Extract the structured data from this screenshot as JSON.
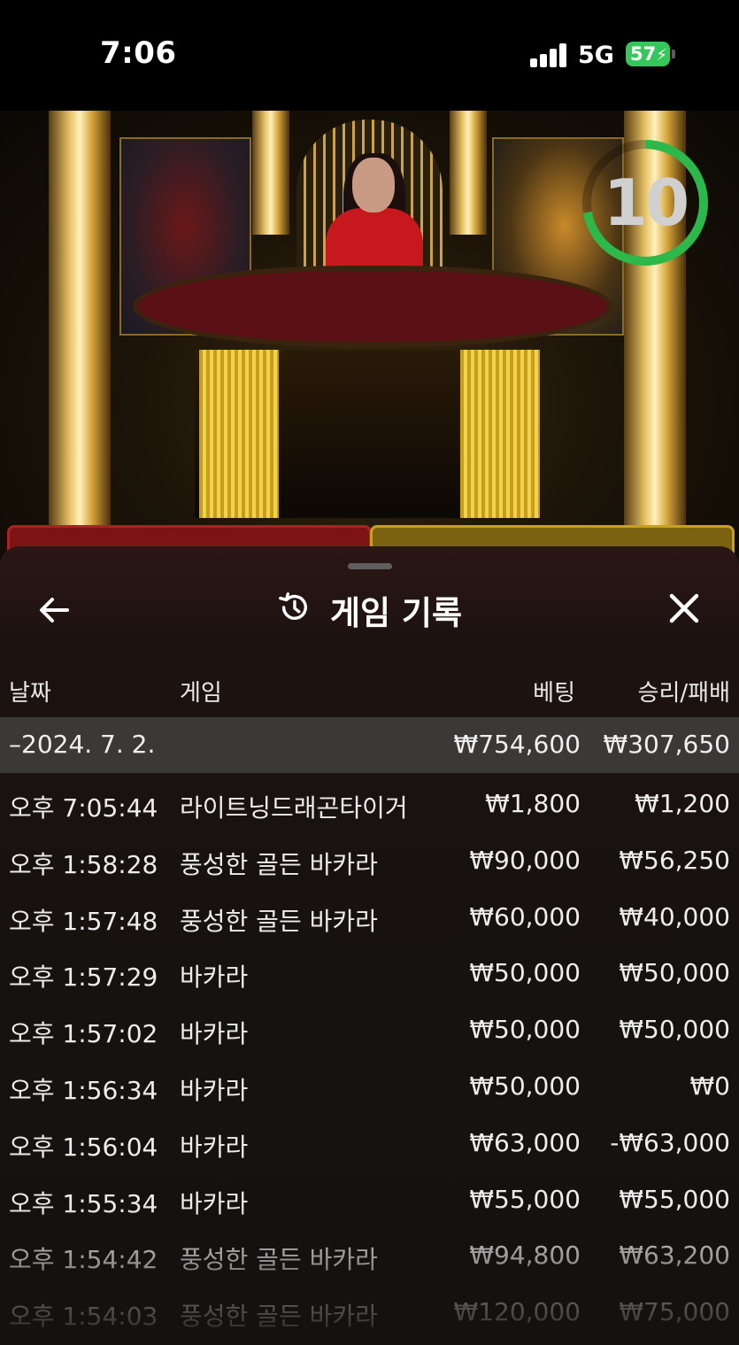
{
  "status_bar": {
    "time": "7:06",
    "network": "5G",
    "battery": "57"
  },
  "video": {
    "timer": "10"
  },
  "sheet": {
    "title": "게임 기록",
    "columns": {
      "date": "날짜",
      "game": "게임",
      "bet": "베팅",
      "win_loss": "승리/패배"
    },
    "date_group": {
      "date": "–2024. 7. 2.",
      "bet_total": "₩754,600",
      "win_total": "₩307,650"
    },
    "rows": [
      {
        "time": "오후 7:05:44",
        "game": "라이트닝드래곤타이거",
        "bet": "₩1,800",
        "win": "₩1,200"
      },
      {
        "time": "오후 1:58:28",
        "game": "풍성한 골든 바카라",
        "bet": "₩90,000",
        "win": "₩56,250"
      },
      {
        "time": "오후 1:57:48",
        "game": "풍성한 골든 바카라",
        "bet": "₩60,000",
        "win": "₩40,000"
      },
      {
        "time": "오후 1:57:29",
        "game": "바카라",
        "bet": "₩50,000",
        "win": "₩50,000"
      },
      {
        "time": "오후 1:57:02",
        "game": "바카라",
        "bet": "₩50,000",
        "win": "₩50,000"
      },
      {
        "time": "오후 1:56:34",
        "game": "바카라",
        "bet": "₩50,000",
        "win": "₩0"
      },
      {
        "time": "오후 1:56:04",
        "game": "바카라",
        "bet": "₩63,000",
        "win": "-₩63,000"
      },
      {
        "time": "오후 1:55:34",
        "game": "바카라",
        "bet": "₩55,000",
        "win": "₩55,000"
      },
      {
        "time": "오후 1:54:42",
        "game": "풍성한 골든 바카라",
        "bet": "₩94,800",
        "win": "₩63,200"
      },
      {
        "time": "오후 1:54:03",
        "game": "풍성한 골든 바카라",
        "bet": "₩120,000",
        "win": "₩75,000"
      }
    ]
  },
  "colors": {
    "timer_ring": "#2db84b",
    "battery": "#34c759",
    "date_row_bg": "#3b3838"
  }
}
